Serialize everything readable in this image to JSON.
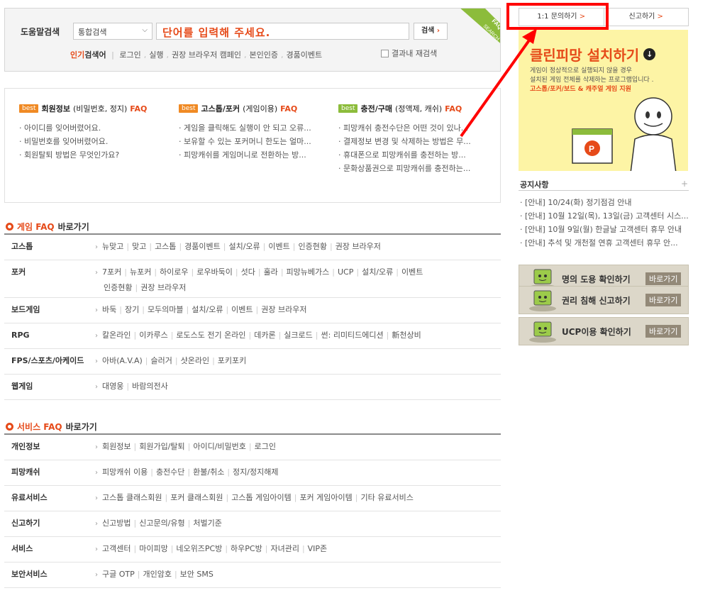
{
  "search": {
    "label": "도움말검색",
    "scope": "통합검색",
    "placeholder": "단어를 입력해 주세요.",
    "button": "검색",
    "popular_label_a": "인기",
    "popular_label_b": "검색어",
    "popular_terms": [
      "로그인",
      "실행",
      "권장 브라우저 캠페인",
      "본인인증",
      "경품이벤트"
    ],
    "result_in_result": "결과내 재검색",
    "ribbon": [
      "FAQ",
      "SEARCH"
    ]
  },
  "best": [
    {
      "tag": "best",
      "title": "회원정보",
      "sub": "(비밀번호, 정지)",
      "faq": "FAQ",
      "items": [
        "아이디를 잊어버렸어요.",
        "비밀번호를 잊어버렸어요.",
        "회원탈퇴 방법은 무엇인가요?"
      ]
    },
    {
      "tag": "best",
      "title": "고스톱/포커",
      "sub": "(게임이용)",
      "faq": "FAQ",
      "items": [
        "게임을 클릭해도 실행이 안 되고 오류...",
        "보유할 수 있는 포커머니 한도는 얼마...",
        "피망캐쉬를 게임머니로 전환하는 방..."
      ]
    },
    {
      "tag": "best",
      "title": "충전/구매",
      "sub": "(정액제, 캐쉬)",
      "faq": "FAQ",
      "items": [
        "피망캐쉬 충전수단은 어떤 것이 있나...",
        "결제정보 변경 및 삭제하는 방법은 무...",
        "휴대폰으로 피망캐쉬를 충전하는 방...",
        "문화상품권으로 피망캐쉬를 충전하는..."
      ]
    }
  ],
  "game_faq": {
    "title_a": "게임 FAQ",
    "title_b": "바로가기",
    "rows": [
      {
        "name": "고스톱",
        "links": [
          "뉴맞고",
          "맞고",
          "고스톱",
          "경품이벤트",
          "설치/오류",
          "이벤트",
          "인증현황",
          "권장 브라우저"
        ]
      },
      {
        "name": "포커",
        "links": [
          "7포커",
          "뉴포커",
          "하이로우",
          "로우바둑이",
          "섯다",
          "훌라",
          "피망뉴베가스",
          "UCP",
          "설치/오류",
          "이벤트"
        ],
        "links2": [
          "인증현황",
          "권장 브라우저"
        ]
      },
      {
        "name": "보드게임",
        "links": [
          "바둑",
          "장기",
          "모두의마블",
          "설치/오류",
          "이벤트",
          "권장 브라우저"
        ]
      },
      {
        "name": "RPG",
        "links": [
          "칼온라인",
          "이카루스",
          "로도스도 전기 온라인",
          "데카론",
          "실크로드",
          "썬: 리미티드에디션",
          "新천상비"
        ]
      },
      {
        "name": "FPS/스포츠/아케이드",
        "links": [
          "아바(A.V.A)",
          "슬러거",
          "샷온라인",
          "포키포키"
        ]
      },
      {
        "name": "웹게임",
        "links": [
          "대영웅",
          "바람의전사"
        ]
      }
    ]
  },
  "service_faq": {
    "title_a": "서비스 FAQ",
    "title_b": "바로가기",
    "rows": [
      {
        "name": "개인정보",
        "links": [
          "회원정보",
          "회원가입/탈퇴",
          "아이디/비밀번호",
          "로그인"
        ]
      },
      {
        "name": "피망캐쉬",
        "links": [
          "피망캐쉬 이용",
          "충전수단",
          "환불/취소",
          "정지/정지해제"
        ]
      },
      {
        "name": "유료서비스",
        "links": [
          "고스톱 클래스회원",
          "포커 클래스회원",
          "고스톱 게임아이템",
          "포커 게임아이템",
          "기타 유료서비스"
        ]
      },
      {
        "name": "신고하기",
        "links": [
          "신고방법",
          "신고문의/유형",
          "처벌기준"
        ]
      },
      {
        "name": "서비스",
        "links": [
          "고객센터",
          "마이피망",
          "네오위즈PC방",
          "하우PC방",
          "자녀관리",
          "VIP존"
        ]
      },
      {
        "name": "보안서비스",
        "links": [
          "구글 OTP",
          "개인암호",
          "보안 SMS"
        ]
      }
    ]
  },
  "side": {
    "tab_inquiry": "1:1 문의하기",
    "tab_report": "신고하기",
    "gt": ">",
    "banner": {
      "title": "클린피망 설치하기",
      "desc1": "게임이 정상적으로 실행되지 않을 경우",
      "desc2": "설치된 게임 전체를 삭제하는 프로그램입니다 .",
      "desc3": "고스톱/포커/보드 & 캐주얼 게임 지원"
    },
    "notice_title": "공지사항",
    "notice_more": "+",
    "notices": [
      "[안내] 10/24(화) 정기점검 안내",
      "[안내] 10월 12일(목), 13일(금) 고객센터 시스...",
      "[안내] 10월 9일(월) 한글날 고객센터 휴무 안내",
      "[안내] 추석 및 개천절 연휴 고객센터 휴무 안..."
    ],
    "buttons": [
      {
        "label": "명의 도용 확인하기",
        "go": "바로가기"
      },
      {
        "label": "권리 침해 신고하기",
        "go": "바로가기"
      },
      {
        "label": "UCP이용 확인하기",
        "go": "바로가기"
      }
    ]
  },
  "colors": {
    "accent": "#e64a19",
    "annotation_red": "#ff0000",
    "banner_bg": "#fdf4a5",
    "side_btn": "#dcd7c9"
  }
}
